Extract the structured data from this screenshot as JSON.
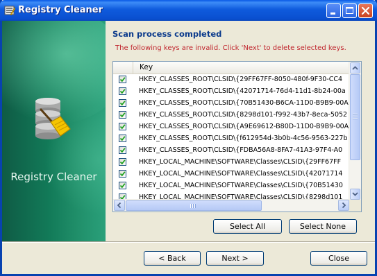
{
  "window": {
    "title": "Registry Cleaner",
    "controls": [
      "minimize-icon",
      "maximize-icon",
      "close-icon"
    ]
  },
  "sidebar": {
    "app_name": "Registry Cleaner",
    "logo_icon": "registry-broom-icon"
  },
  "main": {
    "heading": "Scan process completed",
    "message": "The following keys are invalid. Click 'Next' to delete selected keys.",
    "list": {
      "column_header": "Key",
      "rows": [
        {
          "checked": true,
          "key": "HKEY_CLASSES_ROOT\\CLSID\\{29FF67FF-8050-480f-9F30-CC4"
        },
        {
          "checked": true,
          "key": "HKEY_CLASSES_ROOT\\CLSID\\{42071714-76d4-11d1-8b24-00a"
        },
        {
          "checked": true,
          "key": "HKEY_CLASSES_ROOT\\CLSID\\{70B51430-B6CA-11D0-B9B9-00A"
        },
        {
          "checked": true,
          "key": "HKEY_CLASSES_ROOT\\CLSID\\{8298d101-f992-43b7-8eca-5052"
        },
        {
          "checked": true,
          "key": "HKEY_CLASSES_ROOT\\CLSID\\{A9E69612-B80D-11D0-B9B9-00A"
        },
        {
          "checked": true,
          "key": "HKEY_CLASSES_ROOT\\CLSID\\{f612954d-3b0b-4c56-9563-227b"
        },
        {
          "checked": true,
          "key": "HKEY_CLASSES_ROOT\\CLSID\\{FDBA56A8-8FA7-41A3-97F4-A0"
        },
        {
          "checked": true,
          "key": "HKEY_LOCAL_MACHINE\\SOFTWARE\\Classes\\CLSID\\{29FF67FF"
        },
        {
          "checked": true,
          "key": "HKEY_LOCAL_MACHINE\\SOFTWARE\\Classes\\CLSID\\{42071714"
        },
        {
          "checked": true,
          "key": "HKEY_LOCAL_MACHINE\\SOFTWARE\\Classes\\CLSID\\{70B51430"
        },
        {
          "checked": true,
          "key": "HKEY_LOCAL_MACHINE\\SOFTWARE\\Classes\\CLSID\\{8298d101"
        }
      ]
    },
    "select_all_label": "Select All",
    "select_none_label": "Select None"
  },
  "footer": {
    "back_label": "< Back",
    "next_label": "Next >",
    "close_label": "Close"
  },
  "colors": {
    "heading": "#0b3a8c",
    "message": "#c0262e",
    "titlebar": "#0a4fd0",
    "sidebar": "#127a58",
    "check": "#21a121"
  }
}
